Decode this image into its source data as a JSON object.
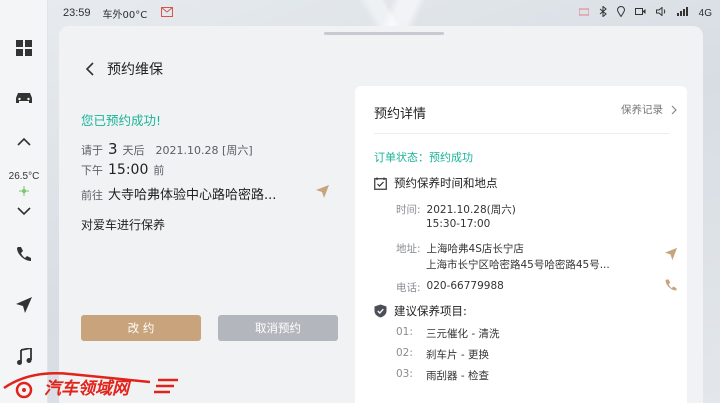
{
  "status_bar": {
    "time": "23:59",
    "weather": "车外00°C",
    "network": "4G"
  },
  "dock": {
    "temperature": "26.5°C"
  },
  "page": {
    "title": "预约维保"
  },
  "summary": {
    "success_text": "您已预约成功!",
    "prefix_please": "请于",
    "days": "3",
    "days_after": "天后",
    "date": "2021.10.28 [周六]",
    "period": "下午",
    "time": "15:00",
    "time_suffix": "前",
    "goto_prefix": "前往",
    "destination": "大寺哈弗体验中心路哈密路...",
    "service": "对爱车进行保养"
  },
  "buttons": {
    "modify": "改 约",
    "cancel": "取消预约"
  },
  "detail": {
    "title": "预约详情",
    "record_link": "保养记录",
    "order_status": "订单状态：预约成功",
    "time_place_title": "预约保养时间和地点",
    "time_label": "时间:",
    "time_value_1": "2021.10.28(周六)",
    "time_value_2": "15:30-17:00",
    "addr_label": "地址:",
    "addr_value_1": "上海哈弗4S店长宁店",
    "addr_value_2": "上海市长宁区哈密路45号哈密路45号...",
    "phone_label": "电话:",
    "phone_value": "020-66779988",
    "items_title": "建议保养项目:",
    "items": [
      {
        "num": "01:",
        "text": "三元催化 - 清洗"
      },
      {
        "num": "02:",
        "text": "刹车片 - 更换"
      },
      {
        "num": "03:",
        "text": "雨刮器 - 检查"
      }
    ]
  },
  "watermark": {
    "text": "汽车领域网"
  },
  "colors": {
    "accent_green": "#19b49a",
    "accent_gold": "#c9a37c",
    "button_gray": "#b3b6bc"
  }
}
